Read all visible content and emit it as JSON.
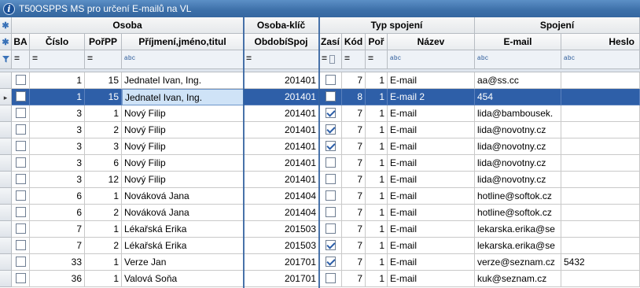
{
  "window": {
    "title": "T50OSPPS MS pro určení E-mailů na VL"
  },
  "grid": {
    "group_headers": [
      "Osoba",
      "Osoba-klíč",
      "Typ spojení",
      "Spojení"
    ],
    "columns": {
      "ba": "BA",
      "cislo": "Číslo",
      "porpp": "PořPP",
      "prijmeni": "Příjmení,jméno,titul",
      "obdobi": "ObdobíSpoj",
      "zasi": "Zasí",
      "kod": "Kód",
      "por": "Poř",
      "nazev": "Název",
      "email": "E-mail",
      "heslo": "Heslo"
    },
    "filter": {
      "equals": "=",
      "text": "abc"
    },
    "rows": [
      {
        "ba": false,
        "cislo": "1",
        "porpp": "15",
        "prijmeni": "Jednatel Ivan, Ing.",
        "obdobi": "201401",
        "zasi": false,
        "kod": "7",
        "por": "1",
        "nazev": "E-mail",
        "email": "aa@ss.cc",
        "heslo": "",
        "selected": false
      },
      {
        "ba": false,
        "cislo": "1",
        "porpp": "15",
        "prijmeni": "Jednatel Ivan, Ing.",
        "obdobi": "201401",
        "zasi": false,
        "kod": "8",
        "por": "1",
        "nazev": "E-mail 2",
        "email": "454",
        "heslo": "",
        "selected": true
      },
      {
        "ba": false,
        "cislo": "3",
        "porpp": "1",
        "prijmeni": "Nový Filip",
        "obdobi": "201401",
        "zasi": true,
        "kod": "7",
        "por": "1",
        "nazev": "E-mail",
        "email": "lida@bambousek.",
        "heslo": "",
        "selected": false
      },
      {
        "ba": false,
        "cislo": "3",
        "porpp": "2",
        "prijmeni": "Nový Filip",
        "obdobi": "201401",
        "zasi": true,
        "kod": "7",
        "por": "1",
        "nazev": "E-mail",
        "email": "lida@novotny.cz",
        "heslo": "",
        "selected": false
      },
      {
        "ba": false,
        "cislo": "3",
        "porpp": "3",
        "prijmeni": "Nový Filip",
        "obdobi": "201401",
        "zasi": true,
        "kod": "7",
        "por": "1",
        "nazev": "E-mail",
        "email": "lida@novotny.cz",
        "heslo": "",
        "selected": false
      },
      {
        "ba": false,
        "cislo": "3",
        "porpp": "6",
        "prijmeni": "Nový Filip",
        "obdobi": "201401",
        "zasi": false,
        "kod": "7",
        "por": "1",
        "nazev": "E-mail",
        "email": "lida@novotny.cz",
        "heslo": "",
        "selected": false
      },
      {
        "ba": false,
        "cislo": "3",
        "porpp": "12",
        "prijmeni": "Nový Filip",
        "obdobi": "201401",
        "zasi": false,
        "kod": "7",
        "por": "1",
        "nazev": "E-mail",
        "email": "lida@novotny.cz",
        "heslo": "",
        "selected": false
      },
      {
        "ba": false,
        "cislo": "6",
        "porpp": "1",
        "prijmeni": "Nováková Jana",
        "obdobi": "201404",
        "zasi": false,
        "kod": "7",
        "por": "1",
        "nazev": "E-mail",
        "email": "hotline@softok.cz",
        "heslo": "",
        "selected": false
      },
      {
        "ba": false,
        "cislo": "6",
        "porpp": "2",
        "prijmeni": "Nováková Jana",
        "obdobi": "201404",
        "zasi": false,
        "kod": "7",
        "por": "1",
        "nazev": "E-mail",
        "email": "hotline@softok.cz",
        "heslo": "",
        "selected": false
      },
      {
        "ba": false,
        "cislo": "7",
        "porpp": "1",
        "prijmeni": "Lékařská Erika",
        "obdobi": "201503",
        "zasi": false,
        "kod": "7",
        "por": "1",
        "nazev": "E-mail",
        "email": "lekarska.erika@se",
        "heslo": "",
        "selected": false
      },
      {
        "ba": false,
        "cislo": "7",
        "porpp": "2",
        "prijmeni": "Lékařská Erika",
        "obdobi": "201503",
        "zasi": true,
        "kod": "7",
        "por": "1",
        "nazev": "E-mail",
        "email": "lekarska.erika@se",
        "heslo": "",
        "selected": false
      },
      {
        "ba": false,
        "cislo": "33",
        "porpp": "1",
        "prijmeni": "Verze Jan",
        "obdobi": "201701",
        "zasi": true,
        "kod": "7",
        "por": "1",
        "nazev": "E-mail",
        "email": "verze@seznam.cz",
        "heslo": "5432",
        "selected": false
      },
      {
        "ba": false,
        "cislo": "36",
        "porpp": "1",
        "prijmeni": "Valová Soňa",
        "obdobi": "201701",
        "zasi": false,
        "kod": "7",
        "por": "1",
        "nazev": "E-mail",
        "email": "kuk@seznam.cz",
        "heslo": "",
        "selected": false
      }
    ]
  },
  "colors": {
    "selection": "#2e5fa8",
    "title_bar": "#3c6fa8",
    "accent": "#3a72b8"
  }
}
